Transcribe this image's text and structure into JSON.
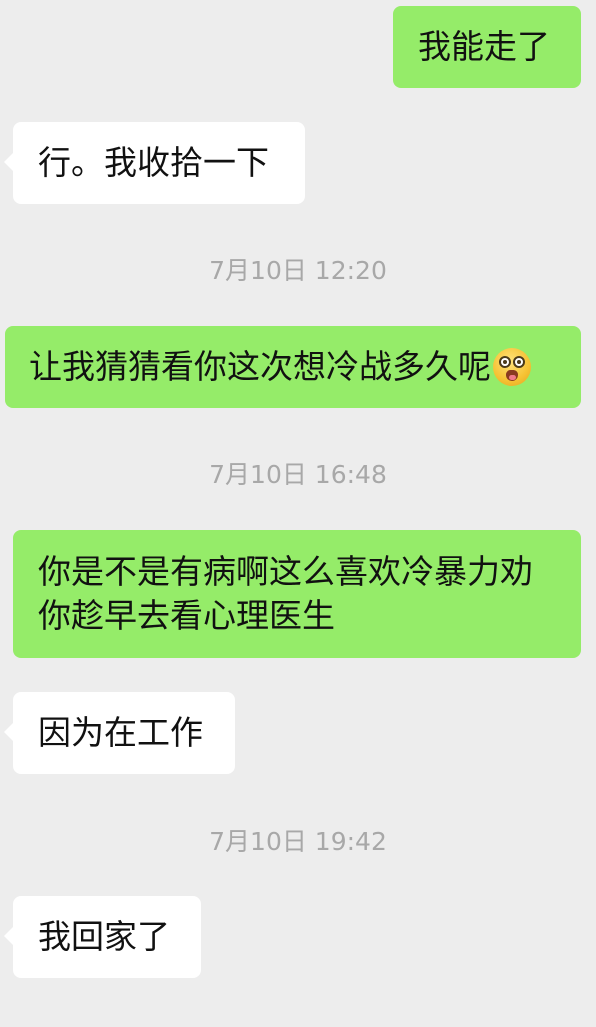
{
  "chat": {
    "messages": [
      {
        "text": "我能走了",
        "sender": "me"
      },
      {
        "text": "行。我收拾一下",
        "sender": "other"
      },
      {
        "timestamp": "7月10日 12:20"
      },
      {
        "text": "让我猜猜看你这次想冷战多久呢",
        "sender": "me",
        "emoji": "astonished-tongue-emoji"
      },
      {
        "timestamp": "7月10日 16:48"
      },
      {
        "lines": [
          "你是不是有病啊这么喜欢冷暴力劝",
          "你趁早去看心理医生"
        ],
        "sender": "me"
      },
      {
        "text": "因为在工作",
        "sender": "other"
      },
      {
        "timestamp": "7月10日 19:42"
      },
      {
        "text": "我回家了",
        "sender": "other"
      }
    ]
  },
  "colors": {
    "background": "#ededed",
    "outgoing_bubble": "#95ec69",
    "incoming_bubble": "#ffffff",
    "timestamp_text": "#a8a8a8",
    "message_text": "#111111"
  }
}
